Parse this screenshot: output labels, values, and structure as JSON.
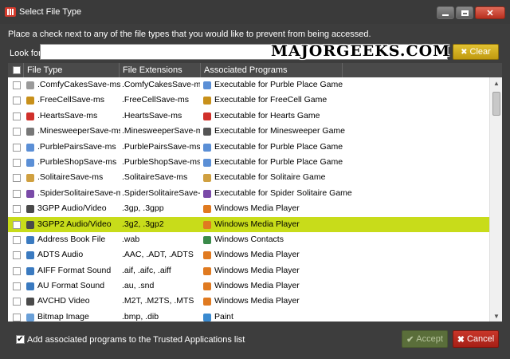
{
  "window": {
    "title": "Select File Type"
  },
  "instruction": "Place a check next to any of the file types that you would like to prevent from being accessed.",
  "search": {
    "label": "Look for",
    "value": "",
    "clear_label": "Clear"
  },
  "watermark": "MAJORGEEKS.COM",
  "table": {
    "columns": [
      "File Type",
      "File Extensions",
      "Associated Programs"
    ],
    "rows": [
      {
        "type": ".ComfyCakesSave-ms",
        "ext": ".ComfyCakesSave-ms",
        "program": "Executable for Purble Place Game",
        "icon": "game-save-icon",
        "pcolor": "#5b8fd6",
        "tcolor": "#9a9a9a"
      },
      {
        "type": ".FreeCellSave-ms",
        "ext": ".FreeCellSave-ms",
        "program": "Executable for FreeCell Game",
        "icon": "game-save-icon",
        "pcolor": "#c8901a",
        "tcolor": "#c8901a"
      },
      {
        "type": ".HeartsSave-ms",
        "ext": ".HeartsSave-ms",
        "program": "Executable for Hearts Game",
        "icon": "game-save-icon",
        "pcolor": "#d0302a",
        "tcolor": "#d0302a"
      },
      {
        "type": ".MinesweeperSave-ms",
        "ext": ".MinesweeperSave-ms",
        "program": "Executable for Minesweeper Game",
        "icon": "game-save-icon",
        "pcolor": "#555555",
        "tcolor": "#777777"
      },
      {
        "type": ".PurblePairsSave-ms",
        "ext": ".PurblePairsSave-ms",
        "program": "Executable for Purble Place Game",
        "icon": "game-save-icon",
        "pcolor": "#5b8fd6",
        "tcolor": "#5b8fd6"
      },
      {
        "type": ".PurbleShopSave-ms",
        "ext": ".PurbleShopSave-ms",
        "program": "Executable for Purble Place Game",
        "icon": "game-save-icon",
        "pcolor": "#5b8fd6",
        "tcolor": "#5b8fd6"
      },
      {
        "type": ".SolitaireSave-ms",
        "ext": ".SolitaireSave-ms",
        "program": "Executable for Solitaire Game",
        "icon": "game-save-icon",
        "pcolor": "#d0a040",
        "tcolor": "#d0a040"
      },
      {
        "type": ".SpiderSolitaireSave-ms",
        "ext": ".SpiderSolitaireSave-ms",
        "program": "Executable for Spider Solitaire Game",
        "icon": "game-save-icon",
        "pcolor": "#7a4aa8",
        "tcolor": "#7a4aa8"
      },
      {
        "type": "3GPP Audio/Video",
        "ext": ".3gp, .3gpp",
        "program": "Windows Media Player",
        "icon": "media-file-icon",
        "pcolor": "#e07a20",
        "tcolor": "#4a4a4a"
      },
      {
        "type": "3GPP2 Audio/Video",
        "ext": ".3g2, .3gp2",
        "program": "Windows Media Player",
        "icon": "media-file-icon",
        "pcolor": "#e07a20",
        "tcolor": "#4a4a4a",
        "selected": true
      },
      {
        "type": "Address Book File",
        "ext": ".wab",
        "program": "Windows Contacts",
        "icon": "contacts-icon",
        "pcolor": "#3a8a4a",
        "tcolor": "#3a7ac0"
      },
      {
        "type": "ADTS Audio",
        "ext": ".AAC, .ADT, .ADTS",
        "program": "Windows Media Player",
        "icon": "audio-file-icon",
        "pcolor": "#e07a20",
        "tcolor": "#3a7ac0"
      },
      {
        "type": "AIFF Format Sound",
        "ext": ".aif, .aifc, .aiff",
        "program": "Windows Media Player",
        "icon": "audio-file-icon",
        "pcolor": "#e07a20",
        "tcolor": "#3a7ac0"
      },
      {
        "type": "AU Format Sound",
        "ext": ".au, .snd",
        "program": "Windows Media Player",
        "icon": "audio-file-icon",
        "pcolor": "#e07a20",
        "tcolor": "#3a7ac0"
      },
      {
        "type": "AVCHD Video",
        "ext": ".M2T, .M2TS, .MTS",
        "program": "Windows Media Player",
        "icon": "video-file-icon",
        "pcolor": "#e07a20",
        "tcolor": "#4a4a4a"
      },
      {
        "type": "Bitmap Image",
        "ext": ".bmp, .dib",
        "program": "Paint",
        "icon": "image-file-icon",
        "pcolor": "#3a8ad0",
        "tcolor": "#6aa0d8"
      }
    ]
  },
  "footer": {
    "trusted_label": "Add associated programs to the Trusted Applications list",
    "trusted_checked": true,
    "accept_label": "Accept",
    "cancel_label": "Cancel"
  },
  "colors": {
    "background": "#3d3d3d",
    "selected_row": "#c8dc1a",
    "clear_button": "#d4b020",
    "cancel_button": "#b8281e",
    "accept_button": "#5a6e3a"
  }
}
